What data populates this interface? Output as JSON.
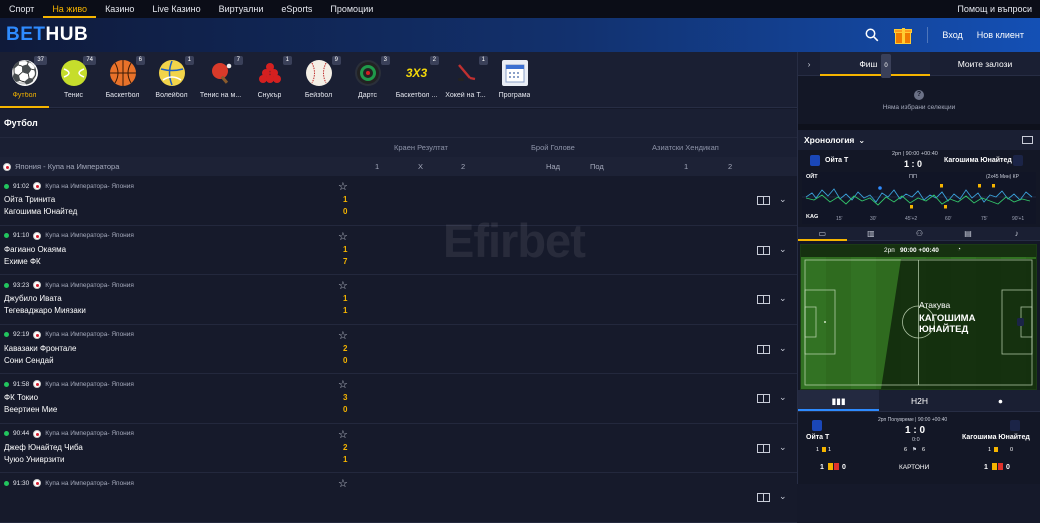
{
  "topnav": {
    "links": [
      "Спорт",
      "На живо",
      "Казино",
      "Live Казино",
      "Виртуални",
      "eSports",
      "Промоции"
    ],
    "help": "Помощ и въпроси"
  },
  "header": {
    "logo_a": "BET",
    "logo_b": "HUB",
    "login": "Вход",
    "register": "Нов клиент"
  },
  "sports": [
    {
      "label": "Футбол",
      "count": "37",
      "icon": "football-icon",
      "glyph": "⚽",
      "bg": "#ffffff"
    },
    {
      "label": "Тенис",
      "count": "74",
      "icon": "tennis-icon",
      "glyph": "",
      "bg": "#c6dd2c"
    },
    {
      "label": "Баскетбол",
      "count": "6",
      "icon": "basketball-icon",
      "glyph": "",
      "bg": "#e8722a"
    },
    {
      "label": "Волейбол",
      "count": "1",
      "icon": "volleyball-icon",
      "glyph": "",
      "bg": "#f2d44a"
    },
    {
      "label": "Тенис на м...",
      "count": "7",
      "icon": "table-tennis-icon",
      "glyph": "",
      "bg": "#d93a2a"
    },
    {
      "label": "Снукър",
      "count": "1",
      "icon": "snooker-icon",
      "glyph": "",
      "bg": "#c42020"
    },
    {
      "label": "Бейзбол",
      "count": "9",
      "icon": "baseball-icon",
      "glyph": "",
      "bg": "#f4efe6"
    },
    {
      "label": "Дартс",
      "count": "3",
      "icon": "darts-icon",
      "glyph": "",
      "bg": "#2a2f3a"
    },
    {
      "label": "Баскетбол ...",
      "count": "2",
      "icon": "basketball-3x3-icon",
      "glyph": "3X3",
      "bg": "transparent"
    },
    {
      "label": "Хокей на Т...",
      "count": "1",
      "icon": "ice-hockey-icon",
      "glyph": "",
      "bg": "transparent"
    },
    {
      "label": "Програма",
      "count": "",
      "icon": "calendar-icon",
      "glyph": "",
      "bg": "#e9edf5"
    }
  ],
  "main": {
    "section_title": "Футбол",
    "market_headers": [
      "Краен Резултат",
      "Брой Голове",
      "Азиатски Хендикап"
    ],
    "league": "Япония - Купа на Императора",
    "cols": [
      "1",
      "X",
      "2",
      "Над",
      "Под",
      "1",
      "2"
    ],
    "matches": [
      {
        "time": "91:02",
        "league": "Купа на Императора- Япония",
        "home": "Ойта Тринита",
        "away": "Кагошима Юнайтед",
        "hs": "1",
        "as": "0"
      },
      {
        "time": "91:10",
        "league": "Купа на Императора- Япония",
        "home": "Фагиано Окаяма",
        "away": "Ехиме ФК",
        "hs": "1",
        "as": "7"
      },
      {
        "time": "93:23",
        "league": "Купа на Императора- Япония",
        "home": "Джубило Ивата",
        "away": "Тегеваджаро Миязаки",
        "hs": "1",
        "as": "1"
      },
      {
        "time": "92:19",
        "league": "Купа на Императора- Япония",
        "home": "Кавазаки Фронтале",
        "away": "Сони Сендай",
        "hs": "2",
        "as": "0"
      },
      {
        "time": "91:58",
        "league": "Купа на Императора- Япония",
        "home": "ФК Токио",
        "away": "Веертиен Мие",
        "hs": "3",
        "as": "0"
      },
      {
        "time": "90:44",
        "league": "Купа на Императора- Япония",
        "home": "Джеф Юнайтед Чиба",
        "away": "Чуюо Униврзити",
        "hs": "2",
        "as": "1"
      },
      {
        "time": "91:30",
        "league": "Купа на Императора- Япония",
        "home": "",
        "away": "",
        "hs": "",
        "as": ""
      }
    ],
    "watermark": "Efirbet"
  },
  "right": {
    "tab_fish": "Фиш",
    "fish_count": "0",
    "tab_bets": "Моите залози",
    "empty": "Няма избрани селекции",
    "chron": "Хронология",
    "home": "Ойта Т",
    "away": "Кагошима Юнайтед",
    "period": "2рп | 90:00 +00:40",
    "score": "1 : 0",
    "graph_home": "ОЙТ",
    "graph_away": "KAG",
    "graph_mid": "ПП",
    "graph_extra": "(2х45 Мин) КР",
    "graph_ticks": [
      "15'",
      "30'",
      "45'+2",
      "60'",
      "75'",
      "90'+1"
    ],
    "pitch_bar": "2рп",
    "pitch_time": "90:00 +00:40",
    "attack_label": "Атакува",
    "attack_team": "КАГОШИМА ЮНАЙТЕД",
    "h2h_tab": "H2H",
    "h2h_period": "2рп Полувреме | 90:00 +00:40",
    "h2h_score": "1 : 0",
    "h2h_ht": "0:0",
    "h2h_corners_l": "6",
    "h2h_corners_r": "6",
    "h2h_cards_lbl": "КАРТОНИ",
    "h2h_card_l1": "1",
    "h2h_card_l2": "0",
    "h2h_card_r1": "1",
    "h2h_card_r2": "0",
    "h2h_row2_l": [
      "1",
      "1"
    ],
    "h2h_row2_r": [
      "1",
      "0"
    ]
  }
}
